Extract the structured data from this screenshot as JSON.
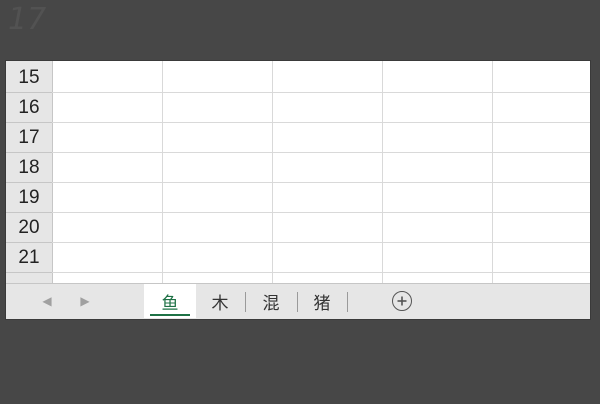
{
  "corner_text": "17",
  "rows": [
    "15",
    "16",
    "17",
    "18",
    "19",
    "20",
    "21"
  ],
  "sheet_nav": {
    "prev_icon": "chevron-left-icon",
    "next_icon": "chevron-right-icon"
  },
  "tabs": [
    {
      "label": "鱼",
      "active": true
    },
    {
      "label": "木",
      "active": false
    },
    {
      "label": "混",
      "active": false
    },
    {
      "label": "猪",
      "active": false
    }
  ],
  "add_sheet_icon": "plus-circle-icon",
  "colors": {
    "active_tab_accent": "#1e7145",
    "background": "#474747",
    "header_gray": "#e6e6e6"
  }
}
